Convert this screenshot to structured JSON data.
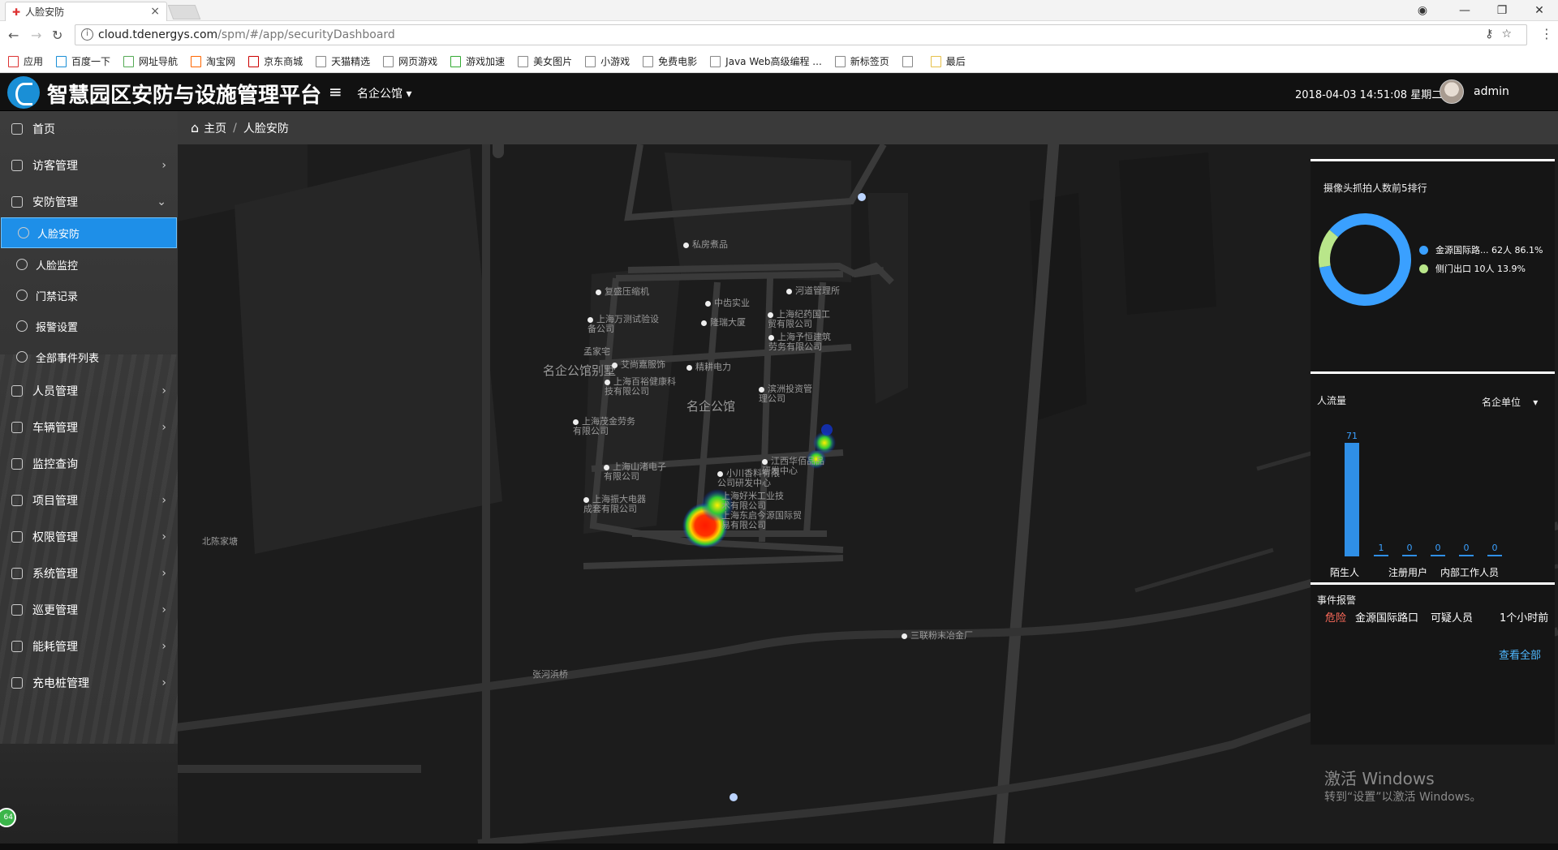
{
  "browser": {
    "tab_title": "人脸安防",
    "url_host": "cloud.tdenergys.com",
    "url_path": "/spm/#/app/securityDashboard",
    "bookmarks": [
      "应用",
      "百度一下",
      "网址导航",
      "淘宝网",
      "京东商城",
      "天猫精选",
      "网页游戏",
      "游戏加速",
      "美女图片",
      "小游戏",
      "免费电影",
      "Java Web高级编程 ...",
      "新标签页",
      "",
      "最后"
    ]
  },
  "header": {
    "title": "智慧园区安防与设施管理平台",
    "park_selector": "名企公馆",
    "datetime": "2018-04-03 14:51:08 星期二",
    "username": "admin"
  },
  "sidebar": {
    "items": [
      {
        "label": "首页",
        "icon": "home-icon"
      },
      {
        "label": "访客管理",
        "icon": "visitor-icon"
      },
      {
        "label": "安防管理",
        "icon": "security-icon"
      },
      {
        "label": "人员管理",
        "icon": "people-icon"
      },
      {
        "label": "车辆管理",
        "icon": "car-icon"
      },
      {
        "label": "监控查询",
        "icon": "monitor-icon"
      },
      {
        "label": "项目管理",
        "icon": "project-icon"
      },
      {
        "label": "权限管理",
        "icon": "shield-icon"
      },
      {
        "label": "系统管理",
        "icon": "gear-icon"
      },
      {
        "label": "巡更管理",
        "icon": "patrol-icon"
      },
      {
        "label": "能耗管理",
        "icon": "energy-icon"
      },
      {
        "label": "充电桩管理",
        "icon": "charger-icon"
      }
    ],
    "sub_items": [
      {
        "label": "人脸安防",
        "active": true
      },
      {
        "label": "人脸监控",
        "active": false
      },
      {
        "label": "门禁记录",
        "active": false
      },
      {
        "label": "报警设置",
        "active": false
      },
      {
        "label": "全部事件列表",
        "active": false
      }
    ],
    "badge": "64"
  },
  "breadcrumb": {
    "home": "主页",
    "current": "人脸安防"
  },
  "map": {
    "districts": [
      "名企公馆别墅",
      "名企公馆"
    ],
    "pois": [
      "私房煮品",
      "复盛压缩机",
      "中齿实业",
      "河道管理所",
      "上海万测试验设备公司",
      "隆瑞大厦",
      "上海纪药国工贸有限公司",
      "上海予恒建筑劳务有限公司",
      "孟家宅",
      "艾尚嘉服饰",
      "精耕电力",
      "上海百裕健康科技有限公司",
      "滨洲投资管理公司",
      "上海茂金劳务有限公司",
      "江西华佰品品研发中心",
      "上海山渚电子有限公司",
      "小川香料有限公司研发中心",
      "上海振大电器成套有限公司",
      "上海好米工业技术有限公司",
      "上海东启今源国际贸易有限公司",
      "北陈家塘",
      "张河浜桥",
      "三联粉末冶金厂"
    ]
  },
  "camera_panel": {
    "title": "摄像头抓拍人数前5排行",
    "legend": [
      {
        "label": "金源国际路... 62人 86.1%",
        "color": "#3aa0ff"
      },
      {
        "label": "侧门出口 10人 13.9%",
        "color": "#b9e68a"
      }
    ],
    "chart_data": {
      "type": "pie",
      "categories": [
        "金源国际路...",
        "侧门出口"
      ],
      "values": [
        62,
        10
      ],
      "percentages": [
        86.1,
        13.9
      ],
      "donut": true
    }
  },
  "flow_panel": {
    "title": "人流量",
    "unit_selector": "名企单位",
    "chart_data": {
      "type": "bar",
      "categories": [
        "陌生人",
        "注册用户",
        "内部工作人员"
      ],
      "values": [
        71,
        1,
        0,
        0,
        0,
        0
      ],
      "value_labels": [
        "71",
        "1",
        "0",
        "0",
        "0",
        "0"
      ],
      "category_labels": [
        "陌生人",
        "注册用户",
        "内部工作人员"
      ]
    }
  },
  "event_panel": {
    "title": "事件报警",
    "level": "危险",
    "location": "金源国际路口",
    "type": "可疑人员",
    "time": "1个小时前",
    "view_all": "查看全部"
  },
  "watermark": {
    "line1": "激活 Windows",
    "line2": "转到“设置”以激活 Windows。"
  }
}
